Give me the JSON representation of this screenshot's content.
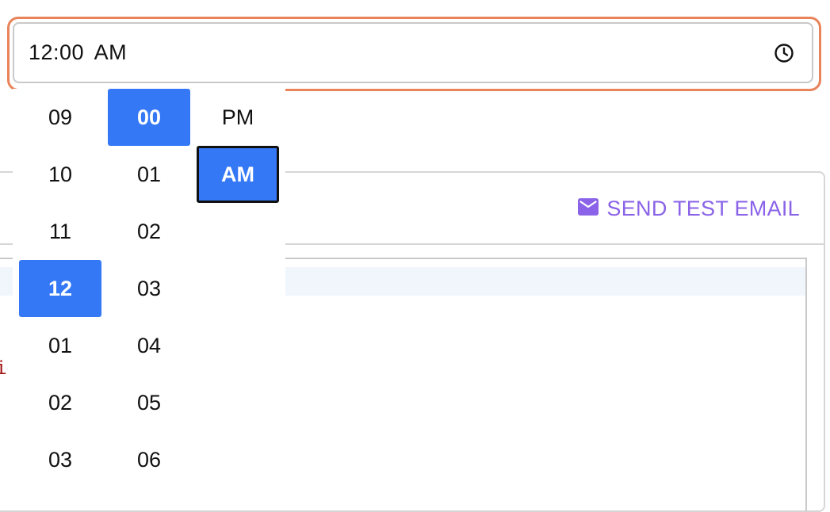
{
  "time_input": {
    "value": "12:00 AM",
    "icon": "clock-icon"
  },
  "picker": {
    "hours": [
      {
        "label": "09",
        "selected": false
      },
      {
        "label": "10",
        "selected": false
      },
      {
        "label": "11",
        "selected": false
      },
      {
        "label": "12",
        "selected": true
      },
      {
        "label": "01",
        "selected": false
      },
      {
        "label": "02",
        "selected": false
      },
      {
        "label": "03",
        "selected": false
      }
    ],
    "minutes": [
      {
        "label": "00",
        "selected": true
      },
      {
        "label": "01",
        "selected": false
      },
      {
        "label": "02",
        "selected": false
      },
      {
        "label": "03",
        "selected": false
      },
      {
        "label": "04",
        "selected": false
      },
      {
        "label": "05",
        "selected": false
      },
      {
        "label": "06",
        "selected": false
      }
    ],
    "ampm": [
      {
        "label": "PM",
        "selected": false
      },
      {
        "label": "AM",
        "selected": true
      }
    ]
  },
  "card": {
    "send_test_email_label": "SEND TEST EMAIL",
    "send_icon": "mail-icon",
    "code_fragment": "i"
  },
  "colors": {
    "focus_ring": "#e8835a",
    "selected": "#3478f6",
    "link_purple": "#8a63e8",
    "code_red": "#a31515"
  }
}
